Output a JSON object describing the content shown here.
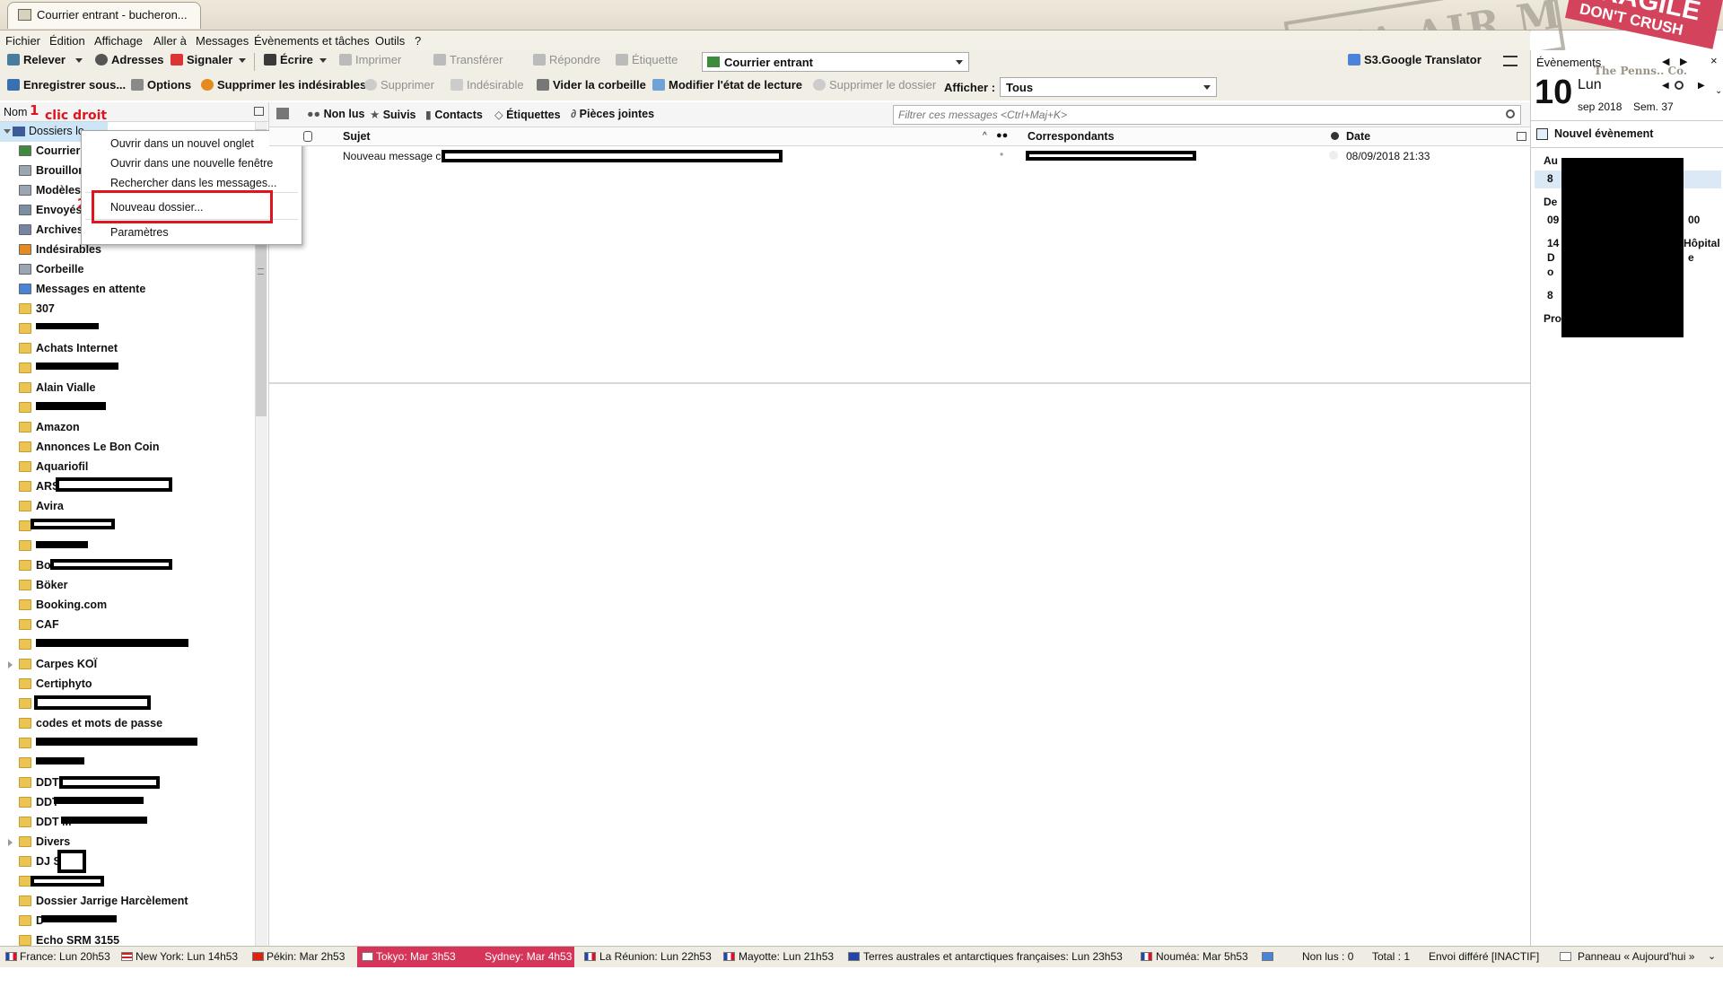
{
  "window": {
    "tab_title": "Courrier entrant - bucheron..."
  },
  "decor": {
    "stamp_text": "VIA AIR MAIL",
    "fragile_title": "FRAGILE",
    "fragile_sub": "DON'T CRUSH",
    "penns_text": "The Penns.. Co."
  },
  "menubar": [
    "Fichier",
    "Édition",
    "Affichage",
    "Aller à",
    "Messages",
    "Évènements et tâches",
    "Outils",
    "?"
  ],
  "toolbar1": {
    "relever": "Relever",
    "adresses": "Adresses",
    "signaler": "Signaler",
    "ecrire": "Écrire",
    "imprimer": "Imprimer",
    "transferer": "Transférer",
    "repondre": "Répondre",
    "etiquette": "Étiquette",
    "folder_select": "Courrier entrant",
    "translator": "S3.Google Translator"
  },
  "toolbar2": {
    "enregistrer": "Enregistrer sous...",
    "options": "Options",
    "suppr_indesirables": "Supprimer les indésirables",
    "supprimer": "Supprimer",
    "indesirable": "Indésirable",
    "vider": "Vider la corbeille",
    "modifier": "Modifier l'état de lecture",
    "suppr_dossier": "Supprimer le dossier",
    "afficher_label": "Afficher :",
    "afficher_value": "Tous"
  },
  "folderpane": {
    "header": "Nom",
    "account": "Dossiers lo",
    "folders": [
      "Courrier",
      "Brouillon",
      "Modèles",
      "Envoyés",
      "Archives",
      "Indésirables",
      "Corbeille",
      "Messages en attente",
      "307",
      "",
      "Achats Internet",
      "",
      "Alain Vialle",
      "",
      "Amazon",
      "Annonces Le Bon Coin",
      "Aquariofil",
      "ARS",
      "Avira",
      "",
      "",
      "Bo",
      "Böker",
      "Booking.com",
      "CAF",
      "",
      "Carpes KOÏ",
      "Certiphyto",
      "",
      "codes et mots de passe",
      "",
      "",
      "DDT",
      "DDT",
      "DDT M",
      "Divers",
      "DJ SO",
      "",
      "Dossier Jarrige Harcèlement",
      "D",
      "Echo SRM 3155"
    ]
  },
  "annotations": {
    "step1_num": "1",
    "step1_text": "clic droit",
    "step2_num": "2"
  },
  "context_menu": {
    "items": [
      "Ouvrir dans un nouvel onglet",
      "Ouvrir dans une nouvelle fenêtre",
      "Rechercher dans les messages...",
      "Nouveau dossier...",
      "Paramètres"
    ],
    "highlighted": "Nouveau dossier..."
  },
  "quickfilter": {
    "non_lus": "Non lus",
    "suivis": "Suivis",
    "contacts": "Contacts",
    "etiquettes": "Étiquettes",
    "pieces": "Pièces jointes",
    "filter_placeholder": "Filtrer ces messages <Ctrl+Maj+K>"
  },
  "columns": {
    "sujet": "Sujet",
    "correspondants": "Correspondants",
    "date": "Date"
  },
  "messages": [
    {
      "subject": "Nouveau message co",
      "date": "08/09/2018 21:33"
    }
  ],
  "calendar": {
    "header": "Évènements",
    "day": "10",
    "weekday": "Lun",
    "month_year": "sep 2018",
    "week": "Sem. 37",
    "new_event": "Nouvel évènement",
    "sec_today": "Au",
    "sec_tomorrow": "De",
    "row_time": "09",
    "row2_a": "14",
    "row2_b": "Hôpital",
    "row2_c": "D",
    "row2_d": "o",
    "row2_e": "e",
    "row_end": "00",
    "sec_later": "Pro",
    "row3": "8",
    "row1": "8"
  },
  "statusbar": {
    "clocks": [
      "France: Lun 20h53",
      "New York: Lun 14h53",
      "Pékin: Mar 2h53",
      "Tokyo: Mar 3h53",
      "Sydney: Mar 4h53",
      "La Réunion: Lun 22h53",
      "Mayotte: Lun 21h53",
      "Terres australes et antarctiques françaises: Lun 23h53",
      "Nouméa: Mar 5h53"
    ],
    "non_lus": "Non lus : 0",
    "total": "Total : 1",
    "envoi": "Envoi différé [INACTIF]",
    "panneau": "Panneau « Aujourd'hui »"
  },
  "colors": {
    "red_annotation": "#e0141e",
    "folder_yellow": "#ecc453",
    "selection_blue": "#cde6f7"
  }
}
